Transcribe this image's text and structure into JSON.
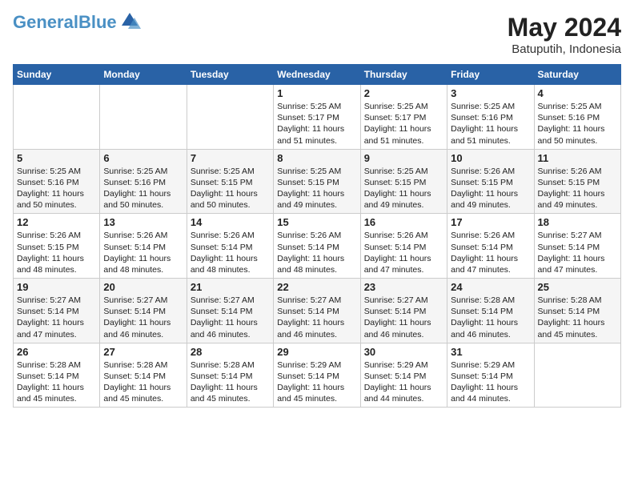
{
  "header": {
    "logo_line1": "General",
    "logo_line2": "Blue",
    "title": "May 2024",
    "location": "Batuputih, Indonesia"
  },
  "weekdays": [
    "Sunday",
    "Monday",
    "Tuesday",
    "Wednesday",
    "Thursday",
    "Friday",
    "Saturday"
  ],
  "weeks": [
    [
      {
        "day": "",
        "info": ""
      },
      {
        "day": "",
        "info": ""
      },
      {
        "day": "",
        "info": ""
      },
      {
        "day": "1",
        "info": "Sunrise: 5:25 AM\nSunset: 5:17 PM\nDaylight: 11 hours\nand 51 minutes."
      },
      {
        "day": "2",
        "info": "Sunrise: 5:25 AM\nSunset: 5:17 PM\nDaylight: 11 hours\nand 51 minutes."
      },
      {
        "day": "3",
        "info": "Sunrise: 5:25 AM\nSunset: 5:16 PM\nDaylight: 11 hours\nand 51 minutes."
      },
      {
        "day": "4",
        "info": "Sunrise: 5:25 AM\nSunset: 5:16 PM\nDaylight: 11 hours\nand 50 minutes."
      }
    ],
    [
      {
        "day": "5",
        "info": "Sunrise: 5:25 AM\nSunset: 5:16 PM\nDaylight: 11 hours\nand 50 minutes."
      },
      {
        "day": "6",
        "info": "Sunrise: 5:25 AM\nSunset: 5:16 PM\nDaylight: 11 hours\nand 50 minutes."
      },
      {
        "day": "7",
        "info": "Sunrise: 5:25 AM\nSunset: 5:15 PM\nDaylight: 11 hours\nand 50 minutes."
      },
      {
        "day": "8",
        "info": "Sunrise: 5:25 AM\nSunset: 5:15 PM\nDaylight: 11 hours\nand 49 minutes."
      },
      {
        "day": "9",
        "info": "Sunrise: 5:25 AM\nSunset: 5:15 PM\nDaylight: 11 hours\nand 49 minutes."
      },
      {
        "day": "10",
        "info": "Sunrise: 5:26 AM\nSunset: 5:15 PM\nDaylight: 11 hours\nand 49 minutes."
      },
      {
        "day": "11",
        "info": "Sunrise: 5:26 AM\nSunset: 5:15 PM\nDaylight: 11 hours\nand 49 minutes."
      }
    ],
    [
      {
        "day": "12",
        "info": "Sunrise: 5:26 AM\nSunset: 5:15 PM\nDaylight: 11 hours\nand 48 minutes."
      },
      {
        "day": "13",
        "info": "Sunrise: 5:26 AM\nSunset: 5:14 PM\nDaylight: 11 hours\nand 48 minutes."
      },
      {
        "day": "14",
        "info": "Sunrise: 5:26 AM\nSunset: 5:14 PM\nDaylight: 11 hours\nand 48 minutes."
      },
      {
        "day": "15",
        "info": "Sunrise: 5:26 AM\nSunset: 5:14 PM\nDaylight: 11 hours\nand 48 minutes."
      },
      {
        "day": "16",
        "info": "Sunrise: 5:26 AM\nSunset: 5:14 PM\nDaylight: 11 hours\nand 47 minutes."
      },
      {
        "day": "17",
        "info": "Sunrise: 5:26 AM\nSunset: 5:14 PM\nDaylight: 11 hours\nand 47 minutes."
      },
      {
        "day": "18",
        "info": "Sunrise: 5:27 AM\nSunset: 5:14 PM\nDaylight: 11 hours\nand 47 minutes."
      }
    ],
    [
      {
        "day": "19",
        "info": "Sunrise: 5:27 AM\nSunset: 5:14 PM\nDaylight: 11 hours\nand 47 minutes."
      },
      {
        "day": "20",
        "info": "Sunrise: 5:27 AM\nSunset: 5:14 PM\nDaylight: 11 hours\nand 46 minutes."
      },
      {
        "day": "21",
        "info": "Sunrise: 5:27 AM\nSunset: 5:14 PM\nDaylight: 11 hours\nand 46 minutes."
      },
      {
        "day": "22",
        "info": "Sunrise: 5:27 AM\nSunset: 5:14 PM\nDaylight: 11 hours\nand 46 minutes."
      },
      {
        "day": "23",
        "info": "Sunrise: 5:27 AM\nSunset: 5:14 PM\nDaylight: 11 hours\nand 46 minutes."
      },
      {
        "day": "24",
        "info": "Sunrise: 5:28 AM\nSunset: 5:14 PM\nDaylight: 11 hours\nand 46 minutes."
      },
      {
        "day": "25",
        "info": "Sunrise: 5:28 AM\nSunset: 5:14 PM\nDaylight: 11 hours\nand 45 minutes."
      }
    ],
    [
      {
        "day": "26",
        "info": "Sunrise: 5:28 AM\nSunset: 5:14 PM\nDaylight: 11 hours\nand 45 minutes."
      },
      {
        "day": "27",
        "info": "Sunrise: 5:28 AM\nSunset: 5:14 PM\nDaylight: 11 hours\nand 45 minutes."
      },
      {
        "day": "28",
        "info": "Sunrise: 5:28 AM\nSunset: 5:14 PM\nDaylight: 11 hours\nand 45 minutes."
      },
      {
        "day": "29",
        "info": "Sunrise: 5:29 AM\nSunset: 5:14 PM\nDaylight: 11 hours\nand 45 minutes."
      },
      {
        "day": "30",
        "info": "Sunrise: 5:29 AM\nSunset: 5:14 PM\nDaylight: 11 hours\nand 44 minutes."
      },
      {
        "day": "31",
        "info": "Sunrise: 5:29 AM\nSunset: 5:14 PM\nDaylight: 11 hours\nand 44 minutes."
      },
      {
        "day": "",
        "info": ""
      }
    ]
  ]
}
